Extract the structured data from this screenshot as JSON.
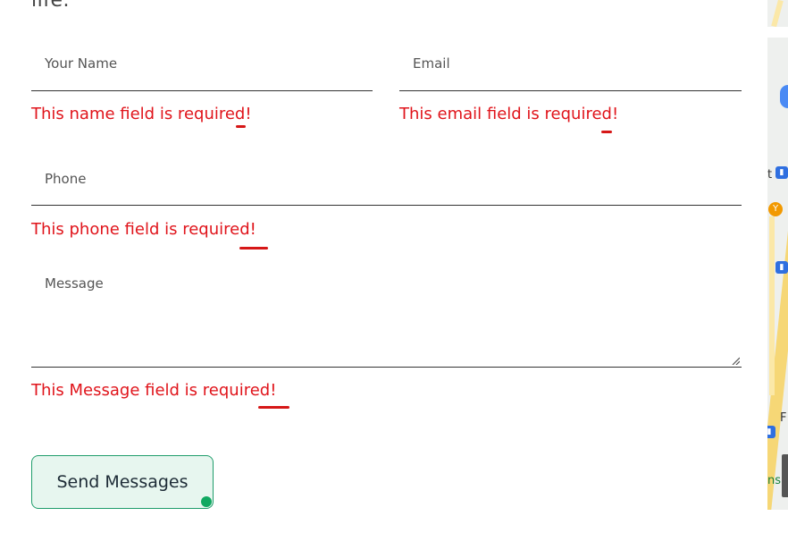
{
  "header": {
    "cutoff_text": "life."
  },
  "form": {
    "name_placeholder": "Your Name",
    "email_placeholder": "Email",
    "phone_placeholder": "Phone",
    "message_placeholder": "Message",
    "name_error": "This name field is required!",
    "email_error": "This email field is required!",
    "phone_error": "This phone field is required!",
    "message_error": "This Message field is required!",
    "submit_label": "Send Messages"
  },
  "colors": {
    "error": "#e0141b",
    "button_border": "#1f9d6b",
    "button_bg": "#e7f6ef",
    "button_dot": "#10a861"
  },
  "map": {
    "icons": [
      "bus-stop-icon",
      "bar-icon",
      "bus-stop-icon",
      "bus-stop-icon",
      "photo-thumbnail"
    ],
    "labels": [
      "t",
      "F",
      "ns"
    ]
  }
}
